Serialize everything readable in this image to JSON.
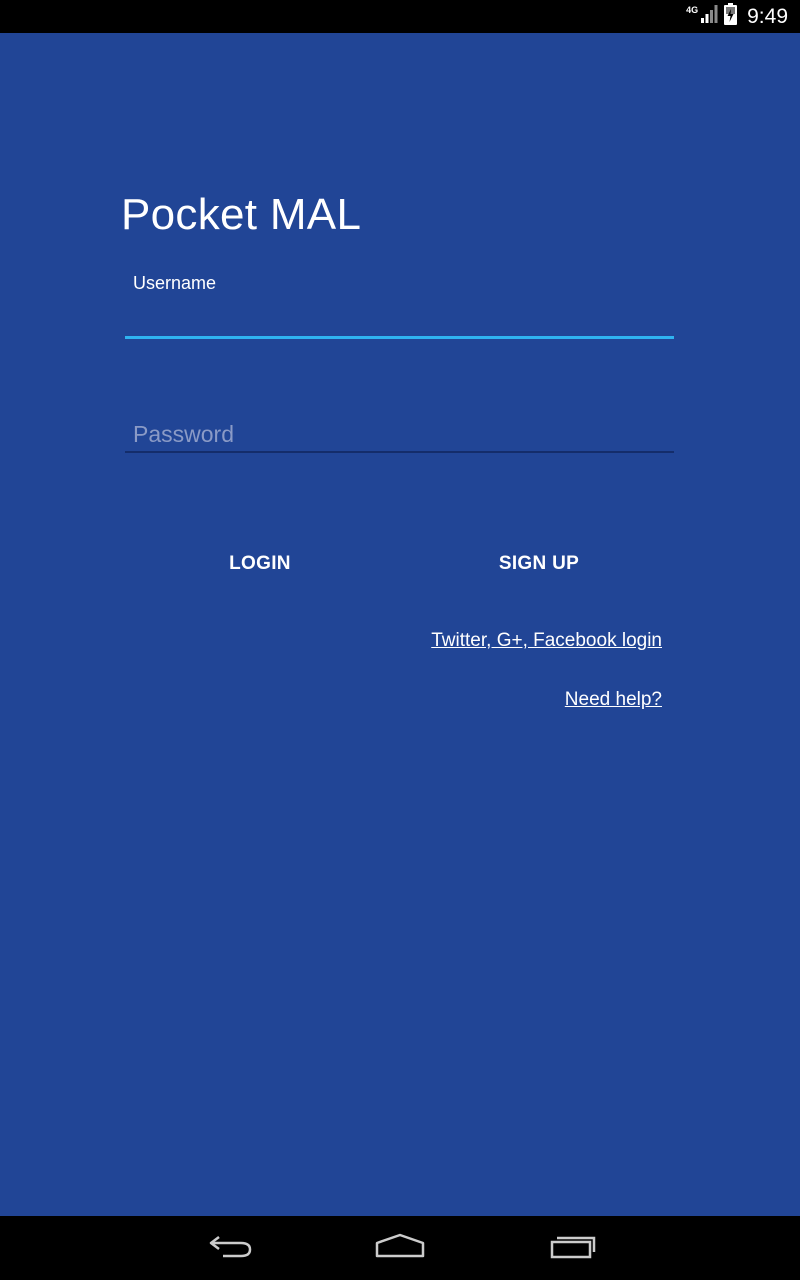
{
  "status_bar": {
    "network": "4G",
    "time": "9:49",
    "icons": [
      "signal-icon",
      "battery-charging-icon"
    ]
  },
  "app": {
    "title": "Pocket MAL"
  },
  "form": {
    "username_label": "Username",
    "username_value": "",
    "password_placeholder": "Password",
    "password_value": ""
  },
  "actions": {
    "login_label": "LOGIN",
    "signup_label": "SIGN UP",
    "social_login_link": "Twitter, G+, Facebook login",
    "help_link": "Need help?"
  },
  "nav_bar": {
    "icons": [
      "back-icon",
      "home-icon",
      "recents-icon"
    ]
  },
  "colors": {
    "background": "#214596",
    "accent": "#2fb3f0",
    "bars": "#000000"
  }
}
